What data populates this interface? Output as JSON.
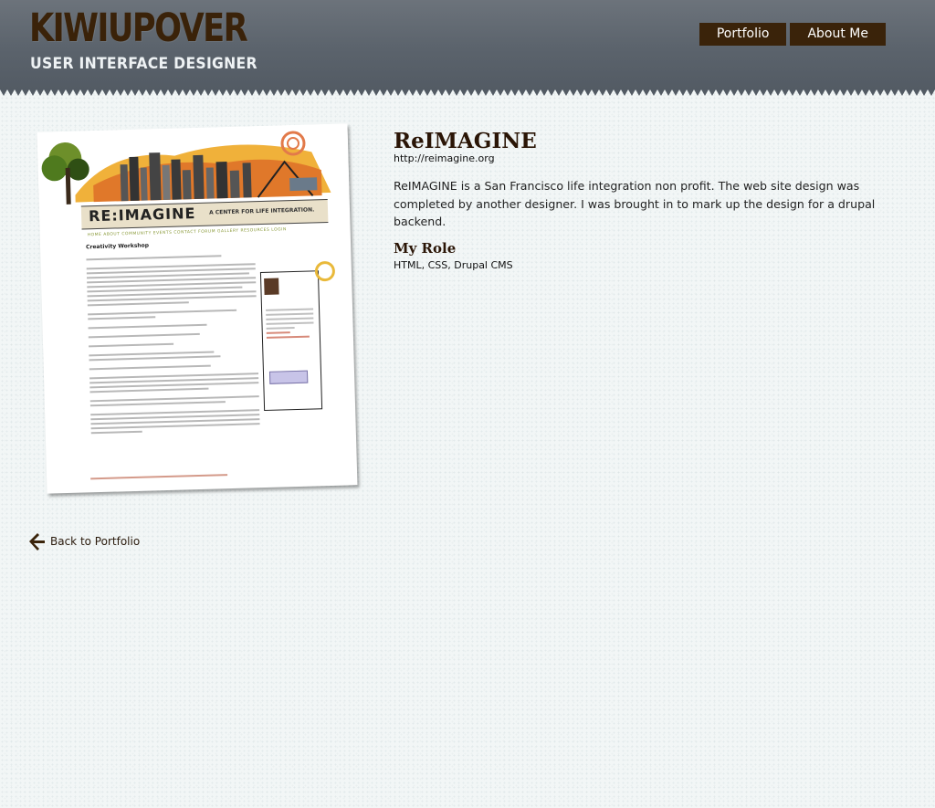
{
  "header": {
    "logo_title": "KIWIUPOVER",
    "logo_subtitle": "USER INTERFACE DESIGNER",
    "nav": [
      {
        "label": "Portfolio"
      },
      {
        "label": "About Me"
      }
    ]
  },
  "project": {
    "title": "ReIMAGINE",
    "url": "http://reimagine.org",
    "description": "ReIMAGINE is a San Francisco life integration non profit. The web site design was completed by another designer. I was brought in to mark up the design for a drupal backend.",
    "role_heading": "My Role",
    "role_text": "HTML, CSS, Drupal CMS"
  },
  "screenshot": {
    "brand": "RE:IMAGINE",
    "tagline": "A CENTER FOR LIFE INTEGRATION.",
    "nav": "HOME  ABOUT  COMMUNITY  EVENTS  CONTACT  FORUM  GALLERY  RESOURCES  LOGIN",
    "heading": "Creativity Workshop"
  },
  "back": {
    "label": "Back to Portfolio",
    "icon": "arrow-left-icon"
  },
  "colors": {
    "header": "#5f666f",
    "brand_brown": "#3a230a",
    "background": "#f2f6f6"
  }
}
